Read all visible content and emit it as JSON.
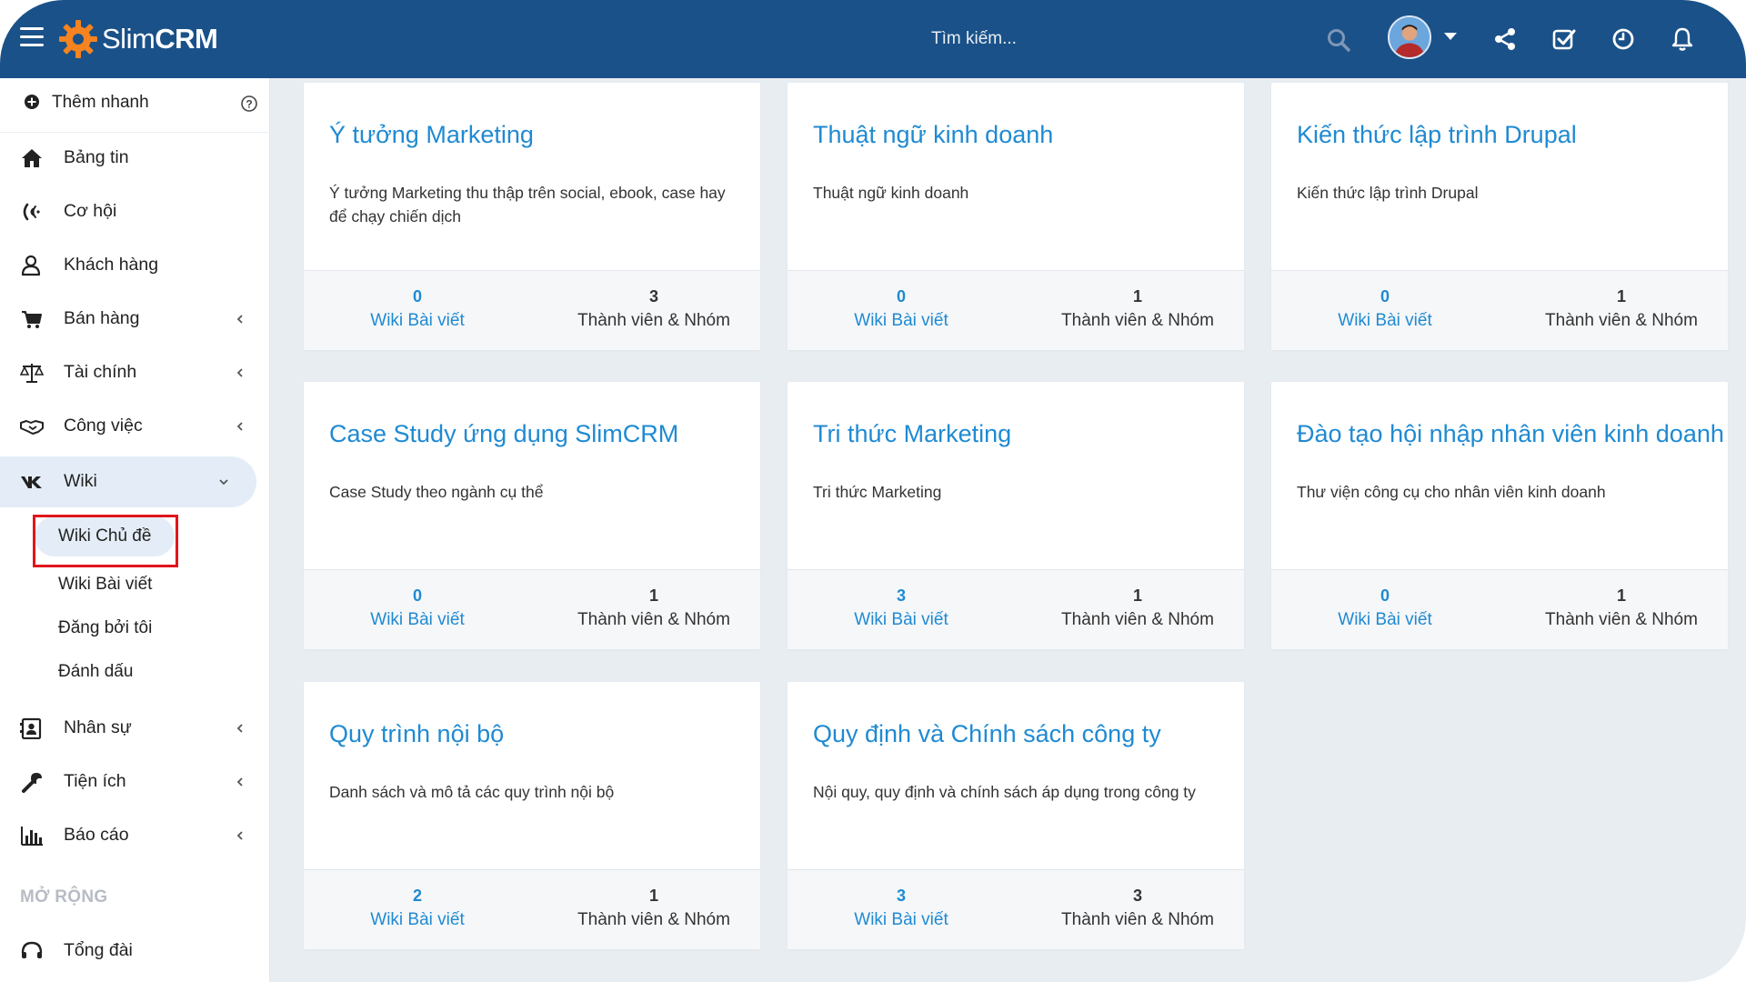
{
  "app": {
    "logo_text_light": "Slim",
    "logo_text_bold": "CRM",
    "brand_color": "#1a5189",
    "accent_color": "#1f8ad2"
  },
  "header": {
    "search_placeholder": "Tìm kiếm...",
    "icons": [
      "menu-icon",
      "search-icon",
      "avatar",
      "share-icon",
      "checkbox-icon",
      "clock-icon",
      "bell-icon"
    ]
  },
  "sidebar": {
    "quick_add": "Thêm nhanh",
    "items": [
      {
        "label": "Bảng tin",
        "icon": "home-icon"
      },
      {
        "label": "Cơ hội",
        "icon": "signal-icon"
      },
      {
        "label": "Khách hàng",
        "icon": "user-icon"
      },
      {
        "label": "Bán hàng",
        "icon": "cart-icon"
      },
      {
        "label": "Tài chính",
        "icon": "balance-icon"
      },
      {
        "label": "Công việc",
        "icon": "handshake-icon"
      },
      {
        "label": "Wiki",
        "icon": "vk-icon"
      }
    ],
    "wiki_sub": [
      {
        "label": "Wiki Chủ đề"
      },
      {
        "label": "Wiki Bài viết"
      },
      {
        "label": "Đăng bởi tôi"
      },
      {
        "label": "Đánh dấu"
      }
    ],
    "items_after": [
      {
        "label": "Nhân sự",
        "icon": "contact-card-icon"
      },
      {
        "label": "Tiện ích",
        "icon": "wrench-icon"
      },
      {
        "label": "Báo cáo",
        "icon": "bar-chart-icon"
      }
    ],
    "section_extend": "MỞ RỘNG",
    "extend_items": [
      {
        "label": "Tổng đài",
        "icon": "headset-icon"
      }
    ]
  },
  "labels": {
    "posts": "Wiki Bài viết",
    "members": "Thành viên & Nhóm"
  },
  "topics": [
    {
      "title": "Ý tưởng Marketing",
      "desc": "Ý tưởng Marketing thu thập trên social, ebook, case hay để chạy chiến dịch",
      "posts": "0",
      "members": "3"
    },
    {
      "title": "Thuật ngữ kinh doanh",
      "desc": "Thuật ngữ kinh doanh",
      "posts": "0",
      "members": "1"
    },
    {
      "title": "Kiến thức lập trình Drupal",
      "desc": "Kiến thức lập trình Drupal",
      "posts": "0",
      "members": "1"
    },
    {
      "title": "Case Study ứng dụng SlimCRM",
      "desc": "Case Study theo ngành cụ thể",
      "posts": "0",
      "members": "1"
    },
    {
      "title": "Tri thức Marketing",
      "desc": "Tri thức Marketing",
      "posts": "3",
      "members": "1"
    },
    {
      "title": "Đào tạo hội nhập nhân viên kinh doanh",
      "desc": "Thư viện công cụ cho nhân viên kinh doanh",
      "posts": "0",
      "members": "1"
    },
    {
      "title": "Quy trình nội bộ",
      "desc": "Danh sách và mô tả các quy trình nội bộ",
      "posts": "2",
      "members": "1"
    },
    {
      "title": "Quy định và Chính sách công ty",
      "desc": "Nội quy, quy định và chính sách áp dụng trong công ty",
      "posts": "3",
      "members": "3"
    }
  ]
}
